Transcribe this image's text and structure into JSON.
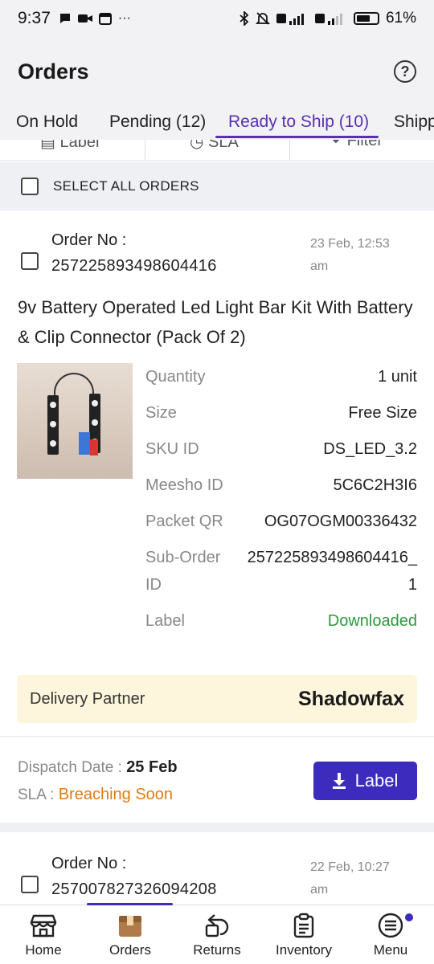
{
  "status_bar": {
    "time": "9:37",
    "battery": "61%"
  },
  "header": {
    "title": "Orders"
  },
  "tabs": [
    {
      "label": "On Hold"
    },
    {
      "label": "Pending (12)"
    },
    {
      "label": "Ready to Ship (10)"
    },
    {
      "label": "Shipp"
    }
  ],
  "filters": {
    "label": "Label",
    "sla": "SLA",
    "filter": "Filter"
  },
  "select_all": {
    "label": "SELECT ALL ORDERS"
  },
  "orders": [
    {
      "order_no_label": "Order No :",
      "order_no": "257225893498604416",
      "date": "23 Feb, 12:53 am",
      "title": "9v Battery Operated Led Light Bar Kit With Battery & Clip Connector (Pack Of 2)",
      "details": [
        {
          "key": "Quantity",
          "value": "1 unit"
        },
        {
          "key": "Size",
          "value": "Free Size"
        },
        {
          "key": "SKU ID",
          "value": "DS_LED_3.2"
        },
        {
          "key": "Meesho ID",
          "value": "5C6C2H3I6"
        },
        {
          "key": "Packet QR",
          "value": "OG07OGM00336432"
        },
        {
          "key": "Sub-Order ID",
          "value": "257225893498604416_1"
        },
        {
          "key": "Label",
          "value": "Downloaded"
        }
      ],
      "delivery_partner_label": "Delivery Partner",
      "delivery_partner": "Shadowfax",
      "dispatch_label": "Dispatch Date :",
      "dispatch_date": "25 Feb",
      "sla_label": "SLA :",
      "sla_value": "Breaching Soon",
      "label_button": "Label"
    },
    {
      "order_no_label": "Order No :",
      "order_no": "257007827326094208",
      "date": "22 Feb, 10:27 am"
    }
  ],
  "bottom_nav": [
    {
      "label": "Home",
      "icon": "store-icon"
    },
    {
      "label": "Orders",
      "icon": "box-icon"
    },
    {
      "label": "Returns",
      "icon": "return-box-icon"
    },
    {
      "label": "Inventory",
      "icon": "clipboard-icon"
    },
    {
      "label": "Menu",
      "icon": "menu-icon"
    }
  ],
  "colors": {
    "accent": "#3c2bbd",
    "tab_active": "#5a2fb0",
    "success": "#2a9a3a",
    "warning": "#e07b10",
    "partner_bg": "#fdf6dc"
  }
}
